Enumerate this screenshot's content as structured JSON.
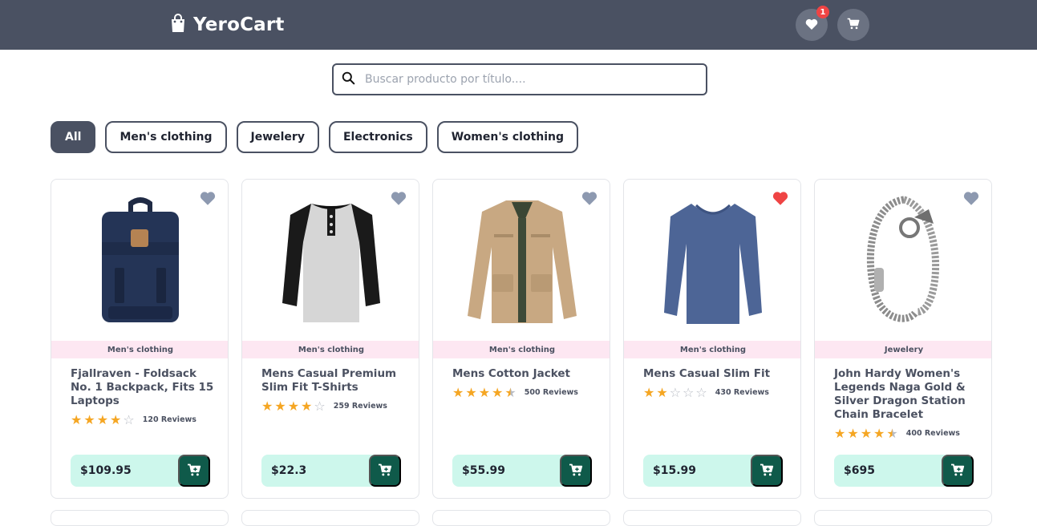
{
  "brand": {
    "name": "YeroCart",
    "icon": "shopping-bag-icon"
  },
  "header": {
    "wishlist_icon": "heart-icon",
    "wishlist_count": "1",
    "cart_icon": "cart-icon",
    "colors": {
      "bar": "#4a5162",
      "badge": "#ef4444"
    }
  },
  "search": {
    "placeholder": "Buscar producto por título....",
    "value": "",
    "icon": "search-icon"
  },
  "filters": [
    {
      "label": "All",
      "active": true
    },
    {
      "label": "Men's clothing",
      "active": false
    },
    {
      "label": "Jewelery",
      "active": false
    },
    {
      "label": "Electronics",
      "active": false
    },
    {
      "label": "Women's clothing",
      "active": false
    }
  ],
  "products": [
    {
      "title": "Fjallraven - Foldsack No. 1 Backpack, Fits 15 Laptops",
      "category": "Men's clothing",
      "rating": 4.0,
      "reviews": "120 Reviews",
      "price": "$109.95",
      "favorite": false,
      "image": "backpack"
    },
    {
      "title": "Mens Casual Premium Slim Fit T-Shirts",
      "category": "Men's clothing",
      "rating": 4.0,
      "reviews": "259 Reviews",
      "price": "$22.3",
      "favorite": false,
      "image": "tshirt"
    },
    {
      "title": "Mens Cotton Jacket",
      "category": "Men's clothing",
      "rating": 4.5,
      "reviews": "500 Reviews",
      "price": "$55.99",
      "favorite": false,
      "image": "jacket"
    },
    {
      "title": "Mens Casual Slim Fit",
      "category": "Men's clothing",
      "rating": 2.0,
      "reviews": "430 Reviews",
      "price": "$15.99",
      "favorite": true,
      "image": "longsleeve"
    },
    {
      "title": "John Hardy Women's Legends Naga Gold & Silver Dragon Station Chain Bracelet",
      "category": "Jewelery",
      "rating": 4.5,
      "reviews": "400 Reviews",
      "price": "$695",
      "favorite": false,
      "image": "bracelet"
    }
  ],
  "colors": {
    "category_bg": "#fde7f2",
    "price_bg": "#cdf7ec",
    "cart_btn": "#0f5a4a",
    "star": "#f5a623",
    "fav_off": "#8d99b0",
    "fav_on": "#ef4444"
  }
}
